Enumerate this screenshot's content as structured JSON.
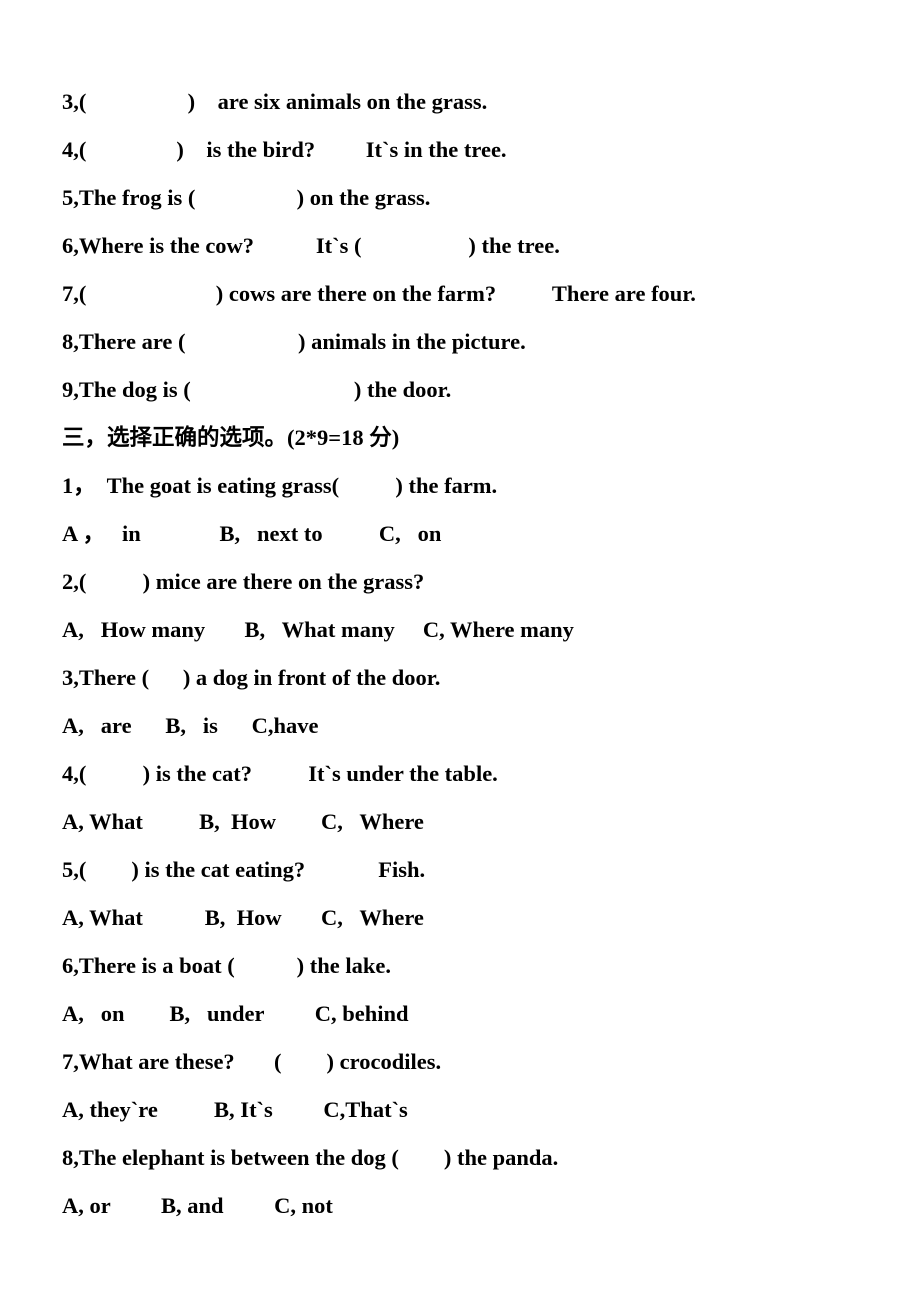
{
  "document": {
    "type": "worksheet",
    "language": "English / Chinese",
    "background_color": "#ffffff",
    "text_color": "#000000"
  },
  "fill_in_blanks": {
    "items": [
      {
        "number": "3",
        "text": "3,(                  )    are six animals on the grass."
      },
      {
        "number": "4",
        "text": "4,(                )    is the bird?         It`s in the tree."
      },
      {
        "number": "5",
        "text": "5,The frog is (                  ) on the grass."
      },
      {
        "number": "6",
        "text": "6,Where is the cow?           It`s (                   ) the tree."
      },
      {
        "number": "7",
        "text": "7,(                       ) cows are there on the farm?          There are four."
      },
      {
        "number": "8",
        "text": "8,There are (                    ) animals in the picture."
      },
      {
        "number": "9",
        "text": "9,The dog is (                             ) the door."
      }
    ]
  },
  "section_three": {
    "heading": "三，选择正确的选项。(2*9=18 分)",
    "questions": [
      {
        "stem": "1，  The goat is eating grass(          ) the farm.",
        "options": "A ，   in              B,   next to          C,   on"
      },
      {
        "stem": "2,(          ) mice are there on the grass?",
        "options": "A,   How many       B,   What many     C, Where many"
      },
      {
        "stem": "3,There (      ) a dog in front of the door.",
        "options": "A,   are      B,   is      C,have"
      },
      {
        "stem": "4,(          ) is the cat?          It`s under the table.",
        "options": "A, What          B,  How        C,   Where"
      },
      {
        "stem": "5,(        ) is the cat eating?             Fish.",
        "options": "A, What           B,  How       C,   Where"
      },
      {
        "stem": "6,There is a boat (           ) the lake.",
        "options": "A,   on        B,   under         C, behind"
      },
      {
        "stem": "7,What are these?       (        ) crocodiles.",
        "options": "A, they`re          B, It`s         C,That`s"
      },
      {
        "stem": "8,The elephant is between the dog (        ) the panda.",
        "options": "A, or         B, and         C, not"
      }
    ]
  }
}
